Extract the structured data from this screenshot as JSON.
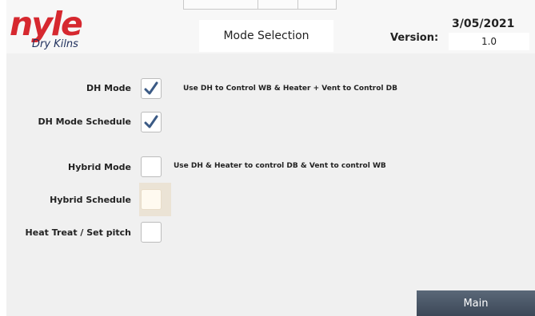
{
  "header": {
    "logo_text": "nyle",
    "logo_subtext": "Dry Kilns",
    "title": "Mode Selection",
    "date": "3/05/2021",
    "version_label": "Version:",
    "version_value": "1.0"
  },
  "modes": [
    {
      "label": "DH Mode",
      "checked": true,
      "description": "Use DH to Control WB & Heater + Vent to Control DB"
    },
    {
      "label": "DH Mode Schedule",
      "checked": true,
      "description": ""
    },
    {
      "label": "Hybrid Mode",
      "checked": false,
      "description": "Use DH & Heater to control DB & Vent to control WB"
    },
    {
      "label": "Hybrid  Schedule",
      "checked": false,
      "disabled": true,
      "description": ""
    },
    {
      "label": "Heat Treat / Set pitch",
      "checked": false,
      "description": ""
    }
  ],
  "footer": {
    "main_button": "Main"
  },
  "colors": {
    "accent": "#d6282f",
    "brand_dark": "#1e2f5c",
    "check": "#3b5a85",
    "button": "#4a5667"
  }
}
